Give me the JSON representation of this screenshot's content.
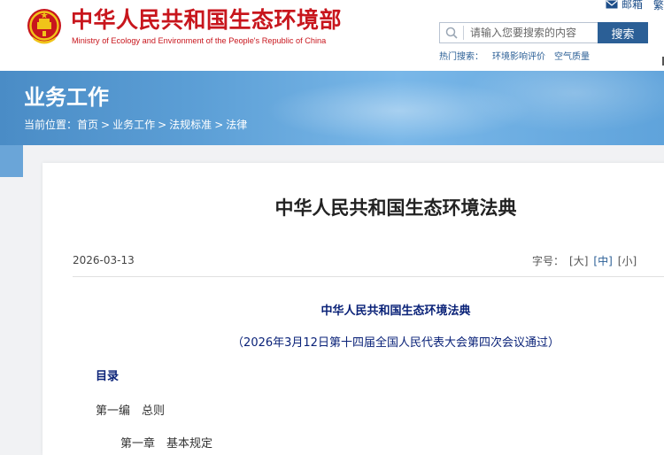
{
  "header": {
    "site_title": "中华人民共和国生态环境部",
    "site_subtitle": "Ministry of Ecology and Environment of the People's Republic of China",
    "top_links": [
      {
        "label": "邮箱",
        "icon": "mail-icon"
      },
      {
        "label": "繁",
        "icon": ""
      }
    ],
    "search": {
      "placeholder": "请输入您要搜索的内容",
      "button_label": "搜索"
    },
    "hot_search": {
      "label": "热门搜索：",
      "items": [
        "环境影响评价",
        "空气质量"
      ]
    }
  },
  "banner": {
    "section_title": "业务工作",
    "breadcrumb": {
      "prefix": "当前位置：",
      "items": [
        "首页",
        "业务工作",
        "法规标准",
        "法律"
      ],
      "separator": ">"
    }
  },
  "article": {
    "title": "中华人民共和国生态环境法典",
    "date": "2026-03-13",
    "font_size": {
      "label": "字号：",
      "options": [
        "[大]",
        "[中]",
        "[小]"
      ],
      "selected": "[中]",
      "trailing": "["
    },
    "body": {
      "law_title": "中华人民共和国生态环境法典",
      "law_note": "（2026年3月12日第十四届全国人民代表大会第四次会议通过）",
      "toc_heading": "目录",
      "part_one": "第一编　总则",
      "chapter_one": "第一章　基本规定"
    }
  },
  "colors": {
    "brand_red": "#c8161d",
    "link_blue": "#2b5f96",
    "body_navy": "#0a2278"
  }
}
